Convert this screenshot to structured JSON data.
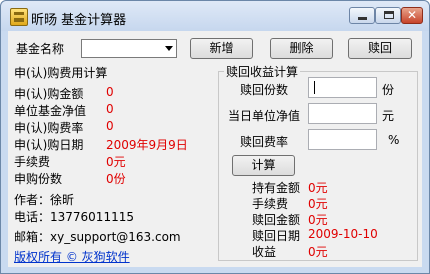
{
  "window": {
    "title": "昕旸 基金计算器",
    "icon": "calculator-app-icon"
  },
  "toolbar": {
    "fund_name_label": "基金名称",
    "fund_select_value": "",
    "add_label": "新增",
    "delete_label": "删除",
    "redeem_label": "赎回"
  },
  "purchase": {
    "group_title": "申(认)购费用计算",
    "amount_label": "申(认)购金额",
    "amount_value": "0",
    "nav_label": "单位基金净值",
    "nav_value": "0",
    "rate_label": "申(认)购费率",
    "rate_value": "0",
    "date_label": "申(认)购日期",
    "date_value": "2009年9月9日",
    "fee_label": "手续费",
    "fee_value": "0元",
    "shares_label": "申购份数",
    "shares_value": "0份"
  },
  "redeem": {
    "group_title": "赎回收益计算",
    "shares_label": "赎回份数",
    "shares_unit": "份",
    "nav_label": "当日单位净值",
    "nav_unit": "元",
    "rate_label": "赎回费率",
    "rate_unit": "%",
    "calc_label": "计算",
    "holding_label": "持有金额",
    "holding_value": "0元",
    "fee_label": "手续费",
    "fee_value": "0元",
    "amount_label": "赎回金额",
    "amount_value": "0元",
    "date_label": "赎回日期",
    "date_value": "2009-10-10",
    "profit_label": "收益",
    "profit_value": "0元"
  },
  "info": {
    "author": "作者：徐昕",
    "phone": "电话：13776011115",
    "email": "邮箱：xy_support@163.com",
    "copyright": "版权所有 © 灰狗软件"
  },
  "colors": {
    "value_red": "#e00000",
    "link_blue": "#0033cc"
  }
}
